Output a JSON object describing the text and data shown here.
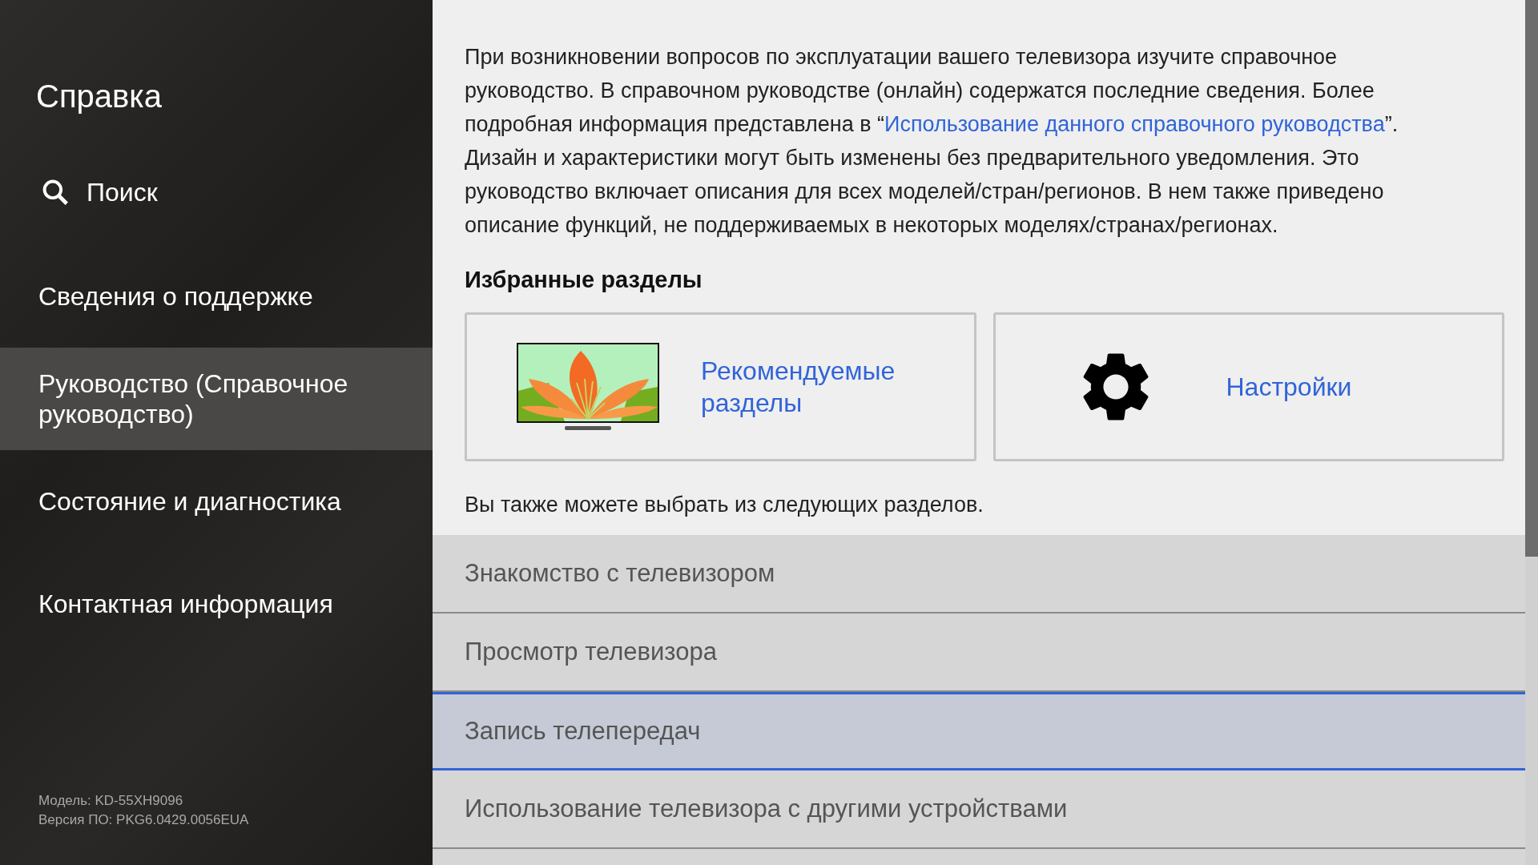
{
  "sidebar": {
    "title": "Справка",
    "search": {
      "label": "Поиск"
    },
    "items": [
      {
        "label": "Сведения о поддержке",
        "selected": false
      },
      {
        "label": "Руководство (Справочное руководство)",
        "selected": true
      },
      {
        "label": "Состояние и диагностика",
        "selected": false
      },
      {
        "label": "Контактная информация",
        "selected": false
      }
    ],
    "footer": [
      "Модель: KD-55XH9096",
      "Версия ПО: PKG6.0429.0056EUA"
    ]
  },
  "intro": {
    "before": "При возникновении вопросов по эксплуатации вашего телевизора изучите справочное руководство. В справочном руководстве (онлайн) содержатся последние сведения. Более подробная информация представлена в “",
    "link": "Использование данного справочного руководства",
    "after": "”. Дизайн и характеристики могут быть изменены без предварительного уведомления. Это руководство включает описания для всех моделей/стран/регионов. В нем также приведено описание функций, не поддерживаемых в некоторых моделях/странах/регионах."
  },
  "favorites": {
    "heading": "Избранные разделы",
    "cards": [
      {
        "kind": "tv",
        "label": "Рекомендуемые разделы"
      },
      {
        "kind": "gear",
        "label": "Настройки"
      }
    ]
  },
  "more_hint": "Вы также можете выбрать из следующих разделов.",
  "topics": [
    {
      "label": "Знакомство с телевизором",
      "selected": false
    },
    {
      "label": "Просмотр телевизора",
      "selected": false
    },
    {
      "label": "Запись телепередач",
      "selected": true
    },
    {
      "label": "Использование телевизора с другими устройствами",
      "selected": false
    }
  ]
}
